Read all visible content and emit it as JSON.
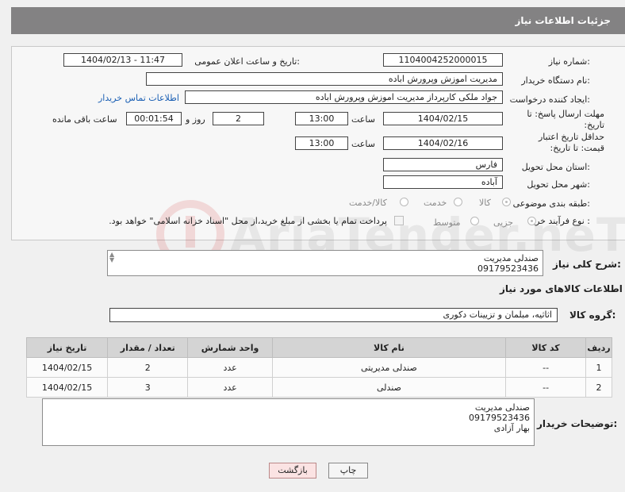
{
  "header": {
    "title": "جزئیات اطلاعات نیاز"
  },
  "form": {
    "need_number_label": "شماره نیاز:",
    "need_number": "1104004252000015",
    "announce_label": "تاریخ و ساعت اعلان عمومی:",
    "announce_value": "1404/02/13 - 11:47",
    "buyer_org_label": "نام دستگاه خریدار:",
    "buyer_org": "مدیریت اموزش وپرورش اباده",
    "creator_label": "ایجاد کننده درخواست:",
    "creator": "جواد ملکی کارپرداز مدیریت اموزش وپرورش اباده",
    "contact_link": "اطلاعات تماس خریدار",
    "reply_deadline_label": "مهلت ارسال پاسخ: تا تاریخ:",
    "reply_date": "1404/02/15",
    "time_label": "ساعت",
    "reply_time": "13:00",
    "days_value": "2",
    "days_label": "روز و",
    "remaining_time": "00:01:54",
    "remaining_label": "ساعت باقی مانده",
    "price_validity_label": "حداقل تاریخ اعتبار قیمت: تا تاریخ:",
    "price_date": "1404/02/16",
    "price_time": "13:00",
    "province_label": "استان محل تحویل:",
    "province": "فارس",
    "city_label": "شهر محل تحویل:",
    "city": "آباده",
    "category_label": "طبقه بندی موضوعی:",
    "category_options": [
      "کالا",
      "خدمت",
      "کالا/خدمت"
    ],
    "process_label": "نوع فرآیند خرید :",
    "process_options": [
      "جزیی",
      "متوسط"
    ],
    "payment_note": "پرداخت تمام یا بخشی از مبلغ خرید،از محل \"اسناد خزانه اسلامی\" خواهد بود."
  },
  "description": {
    "label": "شرح کلی نیاز:",
    "lines": [
      "صندلی مدیریت",
      "09179523436"
    ]
  },
  "goods": {
    "section_title": "اطلاعات کالاهای مورد نیاز",
    "group_label": "گروه کالا:",
    "group_value": "اثاثیه، مبلمان و تزیینات دکوری",
    "columns": [
      "ردیف",
      "کد کالا",
      "نام کالا",
      "واحد شمارش",
      "تعداد / مقدار",
      "تاریخ نیاز"
    ],
    "rows": [
      [
        "1",
        "--",
        "صندلی مدیریتی",
        "عدد",
        "2",
        "1404/02/15"
      ],
      [
        "2",
        "--",
        "صندلی",
        "عدد",
        "3",
        "1404/02/15"
      ]
    ]
  },
  "buyer_notes": {
    "label": "توضیحات خریدار:",
    "lines": [
      "صندلی مدیریت",
      "09179523436",
      "بهار آزادی"
    ]
  },
  "buttons": {
    "print": "چاپ",
    "back": "بازگشت"
  },
  "watermark": {
    "text": "AriaTender.neT"
  },
  "colors": {
    "header_bg": "#838283",
    "link": "#1a5fb4",
    "back_button_bg": "#fbe3e3"
  }
}
